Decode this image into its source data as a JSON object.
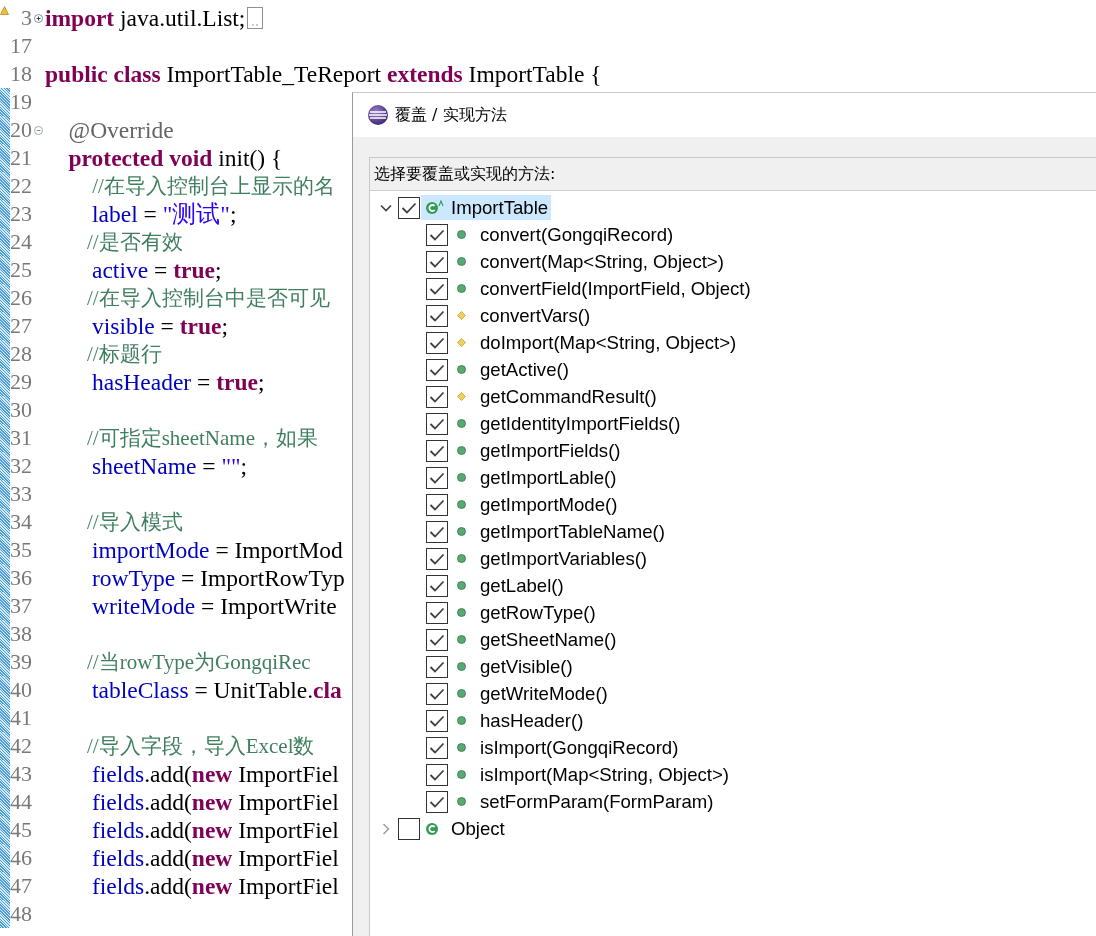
{
  "editor": {
    "lines": [
      {
        "number": "3",
        "folded": true,
        "warning": true,
        "changed": false,
        "tokens": [
          {
            "kind": "keyword",
            "text": "import"
          },
          {
            "kind": "plain",
            "text": " java.util.List;"
          }
        ]
      },
      {
        "number": "17",
        "changed": false
      },
      {
        "number": "18",
        "changed": false,
        "tokens": [
          {
            "kind": "keyword",
            "text": "public class"
          },
          {
            "kind": "plain",
            "text": " ImportTable_TeReport "
          },
          {
            "kind": "keyword",
            "text": "extends"
          },
          {
            "kind": "plain",
            "text": " ImportTable {"
          }
        ]
      },
      {
        "number": "19",
        "changed": true
      },
      {
        "number": "20",
        "folded": false,
        "changed": true,
        "tokens": [
          {
            "kind": "annotation",
            "text": "    @Override"
          }
        ]
      },
      {
        "number": "21",
        "changed": true,
        "tokens": [
          {
            "kind": "keyword",
            "text": "    protected void"
          },
          {
            "kind": "plain",
            "text": " init() {"
          }
        ]
      },
      {
        "number": "22",
        "changed": true,
        "tokens": [
          {
            "kind": "comment",
            "text": "         //在导入控制台上显示的名"
          }
        ]
      },
      {
        "number": "23",
        "changed": true,
        "tokens": [
          {
            "kind": "field",
            "text": "        label"
          },
          {
            "kind": "plain",
            "text": " = "
          },
          {
            "kind": "string",
            "text": "\"测试\""
          },
          {
            "kind": "plain",
            "text": ";"
          }
        ]
      },
      {
        "number": "24",
        "changed": true,
        "tokens": [
          {
            "kind": "comment",
            "text": "        //是否有效"
          }
        ]
      },
      {
        "number": "25",
        "changed": true,
        "tokens": [
          {
            "kind": "field",
            "text": "        active"
          },
          {
            "kind": "plain",
            "text": " = "
          },
          {
            "kind": "keyword",
            "text": "true"
          },
          {
            "kind": "plain",
            "text": ";"
          }
        ]
      },
      {
        "number": "26",
        "changed": true,
        "tokens": [
          {
            "kind": "comment",
            "text": "        //在导入控制台中是否可见"
          }
        ]
      },
      {
        "number": "27",
        "changed": true,
        "tokens": [
          {
            "kind": "field",
            "text": "        visible"
          },
          {
            "kind": "plain",
            "text": " = "
          },
          {
            "kind": "keyword",
            "text": "true"
          },
          {
            "kind": "plain",
            "text": ";"
          }
        ]
      },
      {
        "number": "28",
        "changed": true,
        "tokens": [
          {
            "kind": "comment",
            "text": "        //标题行"
          }
        ]
      },
      {
        "number": "29",
        "changed": true,
        "tokens": [
          {
            "kind": "field",
            "text": "        hasHeader"
          },
          {
            "kind": "plain",
            "text": " = "
          },
          {
            "kind": "keyword",
            "text": "true"
          },
          {
            "kind": "plain",
            "text": ";"
          }
        ]
      },
      {
        "number": "30",
        "changed": true
      },
      {
        "number": "31",
        "changed": true,
        "tokens": [
          {
            "kind": "comment",
            "text": "        //可指定sheetName，如果"
          }
        ]
      },
      {
        "number": "32",
        "changed": true,
        "tokens": [
          {
            "kind": "field",
            "text": "        sheetName"
          },
          {
            "kind": "plain",
            "text": " = "
          },
          {
            "kind": "string",
            "text": "\"\""
          },
          {
            "kind": "plain",
            "text": ";"
          }
        ]
      },
      {
        "number": "33",
        "changed": true
      },
      {
        "number": "34",
        "changed": true,
        "tokens": [
          {
            "kind": "comment",
            "text": "        //导入模式"
          }
        ]
      },
      {
        "number": "35",
        "changed": true,
        "tokens": [
          {
            "kind": "field",
            "text": "        importMode"
          },
          {
            "kind": "plain",
            "text": " = ImportMod"
          }
        ]
      },
      {
        "number": "36",
        "changed": true,
        "tokens": [
          {
            "kind": "field",
            "text": "        rowType"
          },
          {
            "kind": "plain",
            "text": " = ImportRowTyp"
          }
        ]
      },
      {
        "number": "37",
        "changed": true,
        "tokens": [
          {
            "kind": "field",
            "text": "        writeMode"
          },
          {
            "kind": "plain",
            "text": " = ImportWrite"
          }
        ]
      },
      {
        "number": "38",
        "changed": true
      },
      {
        "number": "39",
        "changed": true,
        "tokens": [
          {
            "kind": "comment",
            "text": "        //当rowType为GongqiRec"
          }
        ]
      },
      {
        "number": "40",
        "changed": true,
        "tokens": [
          {
            "kind": "field",
            "text": "        tableClass"
          },
          {
            "kind": "plain",
            "text": " = UnitTable."
          },
          {
            "kind": "keyword",
            "text": "cla"
          }
        ]
      },
      {
        "number": "41",
        "changed": true
      },
      {
        "number": "42",
        "changed": true,
        "tokens": [
          {
            "kind": "comment",
            "text": "        //导入字段，导入Excel数"
          }
        ]
      },
      {
        "number": "43",
        "changed": true,
        "tokens": [
          {
            "kind": "field",
            "text": "        fields"
          },
          {
            "kind": "plain",
            "text": ".add("
          },
          {
            "kind": "keyword",
            "text": "new"
          },
          {
            "kind": "plain",
            "text": " ImportFiel"
          }
        ]
      },
      {
        "number": "44",
        "changed": true,
        "tokens": [
          {
            "kind": "field",
            "text": "        fields"
          },
          {
            "kind": "plain",
            "text": ".add("
          },
          {
            "kind": "keyword",
            "text": "new"
          },
          {
            "kind": "plain",
            "text": " ImportFiel"
          }
        ]
      },
      {
        "number": "45",
        "changed": true,
        "tokens": [
          {
            "kind": "field",
            "text": "        fields"
          },
          {
            "kind": "plain",
            "text": ".add("
          },
          {
            "kind": "keyword",
            "text": "new"
          },
          {
            "kind": "plain",
            "text": " ImportFiel"
          }
        ]
      },
      {
        "number": "46",
        "changed": true,
        "tokens": [
          {
            "kind": "field",
            "text": "        fields"
          },
          {
            "kind": "plain",
            "text": ".add("
          },
          {
            "kind": "keyword",
            "text": "new"
          },
          {
            "kind": "plain",
            "text": " ImportFiel"
          }
        ]
      },
      {
        "number": "47",
        "changed": true,
        "tokens": [
          {
            "kind": "field",
            "text": "        fields"
          },
          {
            "kind": "plain",
            "text": ".add("
          },
          {
            "kind": "keyword",
            "text": "new"
          },
          {
            "kind": "plain",
            "text": " ImportFiel"
          }
        ]
      },
      {
        "number": "48",
        "changed": true
      }
    ]
  },
  "dialog": {
    "title": "覆盖 / 实现方法",
    "prompt": "选择要覆盖或实现的方法:",
    "tree": [
      {
        "label": "ImportTable",
        "checked": true,
        "expanded": true,
        "selected": true,
        "children": [
          {
            "label": "convert(GongqiRecord)",
            "checked": true,
            "kind": "public"
          },
          {
            "label": "convert(Map<String, Object>)",
            "checked": true,
            "kind": "public"
          },
          {
            "label": "convertField(ImportField, Object)",
            "checked": true,
            "kind": "public"
          },
          {
            "label": "convertVars()",
            "checked": true,
            "kind": "protected"
          },
          {
            "label": "doImport(Map<String, Object>)",
            "checked": true,
            "kind": "protected"
          },
          {
            "label": "getActive()",
            "checked": true,
            "kind": "public"
          },
          {
            "label": "getCommandResult()",
            "checked": true,
            "kind": "protected"
          },
          {
            "label": "getIdentityImportFields()",
            "checked": true,
            "kind": "public"
          },
          {
            "label": "getImportFields()",
            "checked": true,
            "kind": "public"
          },
          {
            "label": "getImportLable()",
            "checked": true,
            "kind": "public"
          },
          {
            "label": "getImportMode()",
            "checked": true,
            "kind": "public"
          },
          {
            "label": "getImportTableName()",
            "checked": true,
            "kind": "public"
          },
          {
            "label": "getImportVariables()",
            "checked": true,
            "kind": "public"
          },
          {
            "label": "getLabel()",
            "checked": true,
            "kind": "public"
          },
          {
            "label": "getRowType()",
            "checked": true,
            "kind": "public"
          },
          {
            "label": "getSheetName()",
            "checked": true,
            "kind": "public"
          },
          {
            "label": "getVisible()",
            "checked": true,
            "kind": "public"
          },
          {
            "label": "getWriteMode()",
            "checked": true,
            "kind": "public"
          },
          {
            "label": "hasHeader()",
            "checked": true,
            "kind": "public"
          },
          {
            "label": "isImport(GongqiRecord)",
            "checked": true,
            "kind": "public"
          },
          {
            "label": "isImport(Map<String, Object>)",
            "checked": true,
            "kind": "public"
          },
          {
            "label": "setFormParam(FormParam)",
            "checked": true,
            "kind": "public"
          }
        ]
      },
      {
        "label": "Object",
        "checked": false,
        "expanded": false,
        "selected": false
      }
    ]
  }
}
